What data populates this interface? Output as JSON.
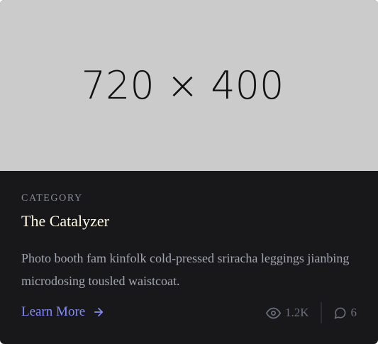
{
  "card": {
    "image_placeholder": "720 × 400",
    "category": "CATEGORY",
    "title": "The Catalyzer",
    "description": "Photo booth fam kinfolk cold-pressed sriracha leggings jianbing microdosing tousled waistcoat.",
    "learn_more_label": "Learn More",
    "learn_more_icon": "arrow-right-icon",
    "stats": {
      "views": "1.2K",
      "views_icon": "eye-icon",
      "comments": "6",
      "comments_icon": "comment-icon"
    }
  },
  "colors": {
    "card_background": "#18181b",
    "image_background": "#cbcbcb",
    "accent": "#818cf8",
    "title": "#fffbe6",
    "muted_text": "#888a96"
  }
}
